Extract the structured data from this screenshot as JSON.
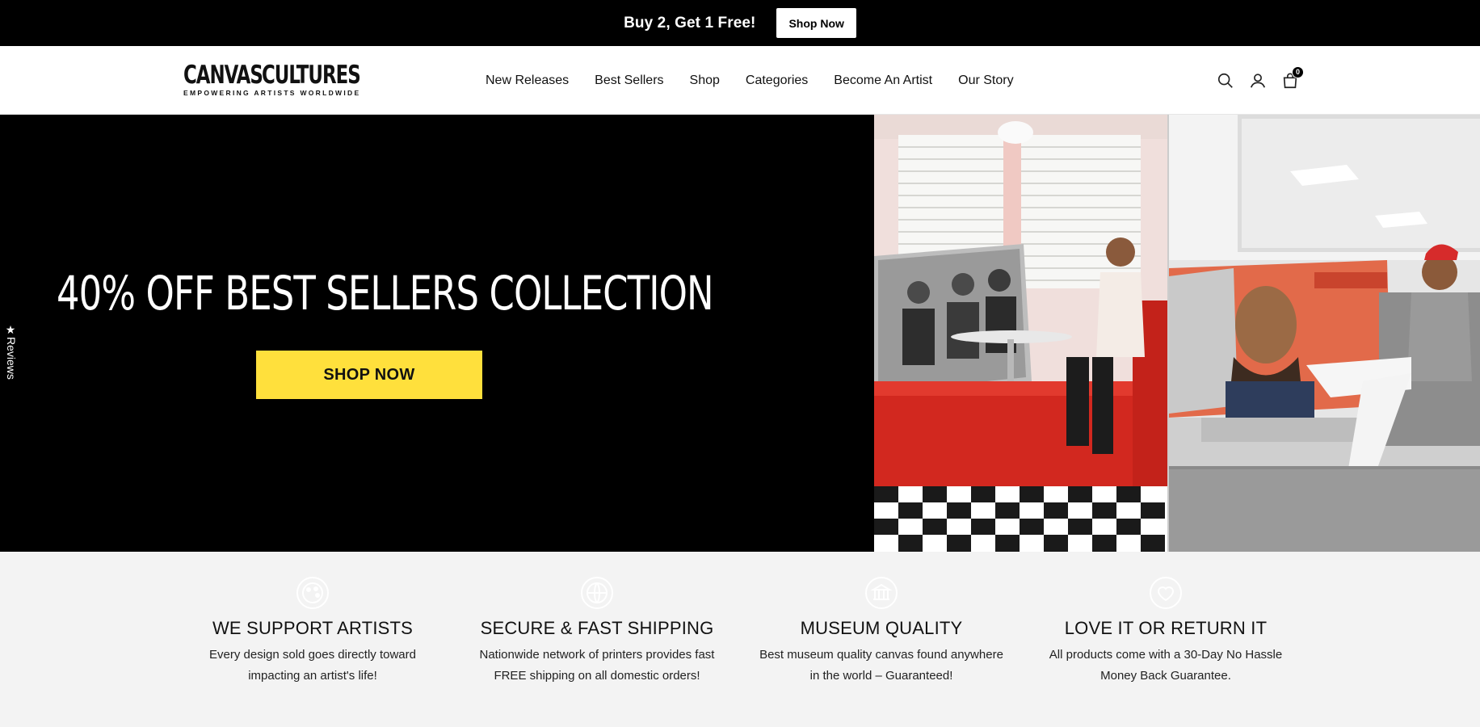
{
  "announcement": {
    "text": "Buy 2, Get 1 Free!",
    "button_label": "Shop Now"
  },
  "logo": {
    "word1": "CANVAS",
    "word2": "CULTURES",
    "tagline": "EMPOWERING ARTISTS WORLDWIDE",
    "flag_colors": [
      "#d8232a",
      "#f7d117",
      "#1f4fa3"
    ]
  },
  "nav": {
    "items": [
      {
        "label": "New Releases"
      },
      {
        "label": "Best Sellers"
      },
      {
        "label": "Shop"
      },
      {
        "label": "Categories"
      },
      {
        "label": "Become An Artist"
      },
      {
        "label": "Our Story"
      }
    ]
  },
  "header_icons": {
    "search": "search-icon",
    "account": "user-icon",
    "cart": "bag-icon",
    "cart_count": "0"
  },
  "hero": {
    "title": "40% OFF BEST SELLERS COLLECTION",
    "button_label": "SHOP NOW",
    "button_color": "#ffe03c"
  },
  "reviews_tab": {
    "label": "★Reviews"
  },
  "features": [
    {
      "icon": "palette-icon",
      "title": "WE SUPPORT ARTISTS",
      "line1": "Every design sold goes directly toward",
      "line2": "impacting an artist's life!"
    },
    {
      "icon": "globe-icon",
      "title": "SECURE & FAST SHIPPING",
      "line1": "Nationwide network of printers provides fast",
      "line2": "FREE shipping on all domestic orders!"
    },
    {
      "icon": "museum-icon",
      "title": "MUSEUM QUALITY",
      "line1": "Best museum quality canvas found anywhere",
      "line2": "in the world – Guaranteed!"
    },
    {
      "icon": "heart-icon",
      "title": "LOVE IT OR RETURN IT",
      "line1": "All products come with a 30-Day No Hassle",
      "line2": "Money Back Guarantee."
    }
  ]
}
